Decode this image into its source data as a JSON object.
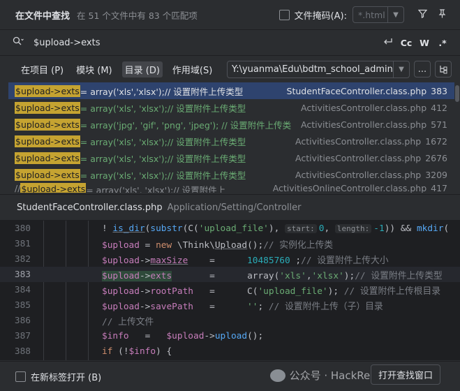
{
  "header": {
    "title": "在文件中查找",
    "subtitle": "在 51 个文件中有 83 个匹配项",
    "file_mask_label": "文件掩码(A):",
    "file_mask_placeholder": "*.html"
  },
  "search": {
    "query": "$upload->exts",
    "case_label": "Cc",
    "word_label": "W",
    "regex_label": ".*"
  },
  "scope": {
    "tabs": [
      {
        "label": "在项目 (P)"
      },
      {
        "label": "模块 (M)"
      },
      {
        "label": "目录 (D)"
      },
      {
        "label": "作用域(S)"
      }
    ],
    "directory": "Y:\\yuanma\\Edu\\bdtm_school_admin",
    "more_label": "..."
  },
  "results": [
    {
      "pre": "",
      "match": "$upload->exts",
      "text": "     =     array('xls','xlsx');// 设置附件上传类型",
      "file": "StudentFaceController.class.php",
      "line": "383"
    },
    {
      "pre": "",
      "match": "$upload->exts",
      "text": " = array('xls', 'xlsx');// 设置附件上传类型",
      "file": "ActivitiesController.class.php",
      "line": "412"
    },
    {
      "pre": "",
      "match": "$upload->exts",
      "text": " = array('jpg', 'gif', 'png', 'jpeg'); // 设置附件上传类",
      "file": "ActivitiesController.class.php",
      "line": "571"
    },
    {
      "pre": "",
      "match": "$upload->exts",
      "text": " = array('xls', 'xlsx');// 设置附件上传类型",
      "file": "ActivitiesController.class.php",
      "line": "1672"
    },
    {
      "pre": "",
      "match": "$upload->exts",
      "text": " = array('xls', 'xlsx');// 设置附件上传类型",
      "file": "ActivitiesController.class.php",
      "line": "2676"
    },
    {
      "pre": "",
      "match": "$upload->exts",
      "text": " = array('xls', 'xlsx');// 设置附件上传类型",
      "file": "ActivitiesController.class.php",
      "line": "3209"
    },
    {
      "pre": "//          ",
      "match": "$upload->exts",
      "text": " = array('xls', 'xlsx');// 设置附件上",
      "file": "ActivitiesOnlineController.class.php",
      "line": "417"
    }
  ],
  "path": {
    "file": "StudentFaceController.class.php",
    "dir": "Application/Setting/Controller"
  },
  "editor": {
    "lines": [
      "380",
      "381",
      "382",
      "383",
      "384",
      "385",
      "386",
      "387",
      "388"
    ],
    "hint_start": "start:",
    "hint_length": "length:",
    "code380_a": "! ",
    "code380_fn1": "is_dir",
    "code380_b": "(",
    "code380_fn2": "substr",
    "code380_c": "(C(",
    "code380_s": "'upload_file'",
    "code380_d": "), ",
    "code380_n1": "0",
    "code380_e": ", ",
    "code380_n2": "-1",
    "code380_f": ")) && ",
    "code380_fn3": "mkdir",
    "code380_g": "(",
    "code381_v": "$upload",
    "code381_a": " = ",
    "code381_kw": "new",
    "code381_b": " \\Think\\",
    "code381_c": "Upload",
    "code381_d": "();",
    "code381_cm": "// 实例化上传类",
    "code382_v": "$upload",
    "code382_a": "->",
    "code382_p": "maxSize",
    "code382_b": "    =      ",
    "code382_n": "10485760",
    "code382_c": " ;",
    "code382_cm": "// 设置附件上传大小",
    "code383_v": "$upload",
    "code383_a": "->",
    "code383_p": "exts",
    "code383_b": "       =      ",
    "code383_c": "array(",
    "code383_s1": "'xls'",
    "code383_d": ",",
    "code383_s2": "'xlsx'",
    "code383_e": ");",
    "code383_cm": "// 设置附件上传类型",
    "code384_v": "$upload",
    "code384_a": "->",
    "code384_p": "rootPath",
    "code384_b": "   =      C(",
    "code384_s": "'upload_file'",
    "code384_c": "); ",
    "code384_cm": "// 设置附件上传根目录",
    "code385_v": "$upload",
    "code385_a": "->",
    "code385_p": "savePath",
    "code385_b": "   =      ",
    "code385_s": "''",
    "code385_c": "; ",
    "code385_cm": "// 设置附件上传（子）目录",
    "code386_cm": "// 上传文件",
    "code387_v": "$info",
    "code387_a": "   =   ",
    "code387_v2": "$upload",
    "code387_b": "->",
    "code387_fn": "upload",
    "code387_c": "();",
    "code388_kw": "if",
    "code388_a": " (!",
    "code388_v": "$info",
    "code388_b": ") {"
  },
  "footer": {
    "new_tab_label": "在新标签打开 (B)",
    "watermark_text": "公众号 · HackRead",
    "open_button": "打开查找窗口"
  }
}
